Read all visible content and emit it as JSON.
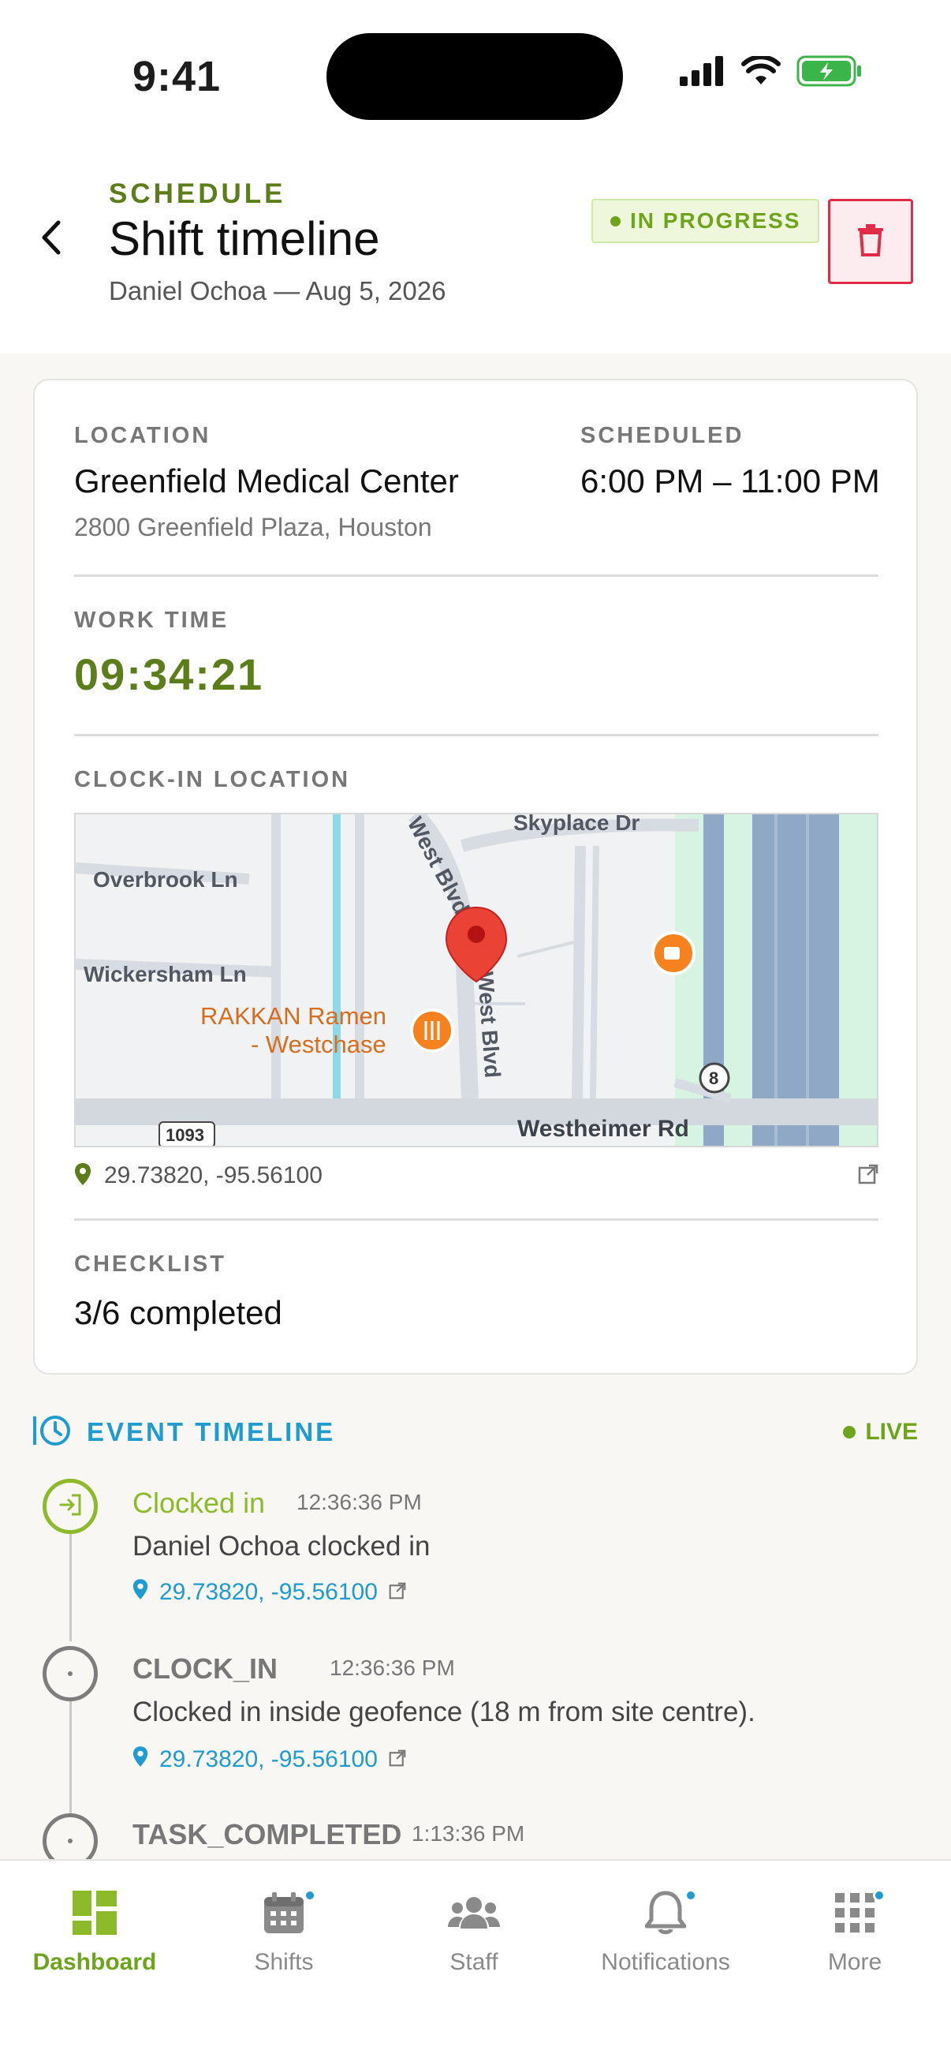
{
  "status_bar": {
    "time": "9:41"
  },
  "header": {
    "eyebrow": "SCHEDULE",
    "title": "Shift timeline",
    "subtitle": "Daniel Ochoa — Aug 5, 2026",
    "status": "IN PROGRESS"
  },
  "details": {
    "location_label": "LOCATION",
    "location_name": "Greenfield Medical Center",
    "location_address": "2800 Greenfield Plaza, Houston",
    "scheduled_label": "SCHEDULED",
    "scheduled_value": "6:00 PM – 11:00 PM",
    "work_time_label": "WORK TIME",
    "work_time": "09:34:21",
    "clockin_label": "CLOCK-IN LOCATION",
    "clockin_coords": "29.73820, -95.56100",
    "checklist_label": "CHECKLIST",
    "checklist_value": "3/6 completed"
  },
  "map": {
    "streets": {
      "skyplace": "Skyplace Dr",
      "overbrook": "Overbrook Ln",
      "wickersham": "Wickersham Ln",
      "westblvd_top": "West Blvd",
      "westblvd": "West Blvd",
      "westheimer": "Westheimer Rd",
      "route_1093": "1093",
      "route_8": "8"
    },
    "poi_line1": "RAKKAN Ramen",
    "poi_line2": "- Westchase"
  },
  "timeline": {
    "title": "EVENT TIMELINE",
    "live_label": "LIVE",
    "events": [
      {
        "title": "Clocked in",
        "time": "12:36:36 PM",
        "description": "Daniel Ochoa clocked in",
        "location": "29.73820, -95.56100"
      },
      {
        "title": "CLOCK_IN",
        "time": "12:36:36 PM",
        "description": "Clocked in inside geofence (18 m from site centre).",
        "location": "29.73820, -95.56100"
      },
      {
        "title": "TASK_COMPLETED",
        "time": "1:13:36 PM"
      }
    ]
  },
  "tabs": [
    {
      "label": "Dashboard",
      "icon": "dashboard-icon",
      "active": true
    },
    {
      "label": "Shifts",
      "icon": "calendar-icon",
      "badge": true
    },
    {
      "label": "Staff",
      "icon": "staff-icon"
    },
    {
      "label": "Notifications",
      "icon": "bell-icon",
      "badge": true
    },
    {
      "label": "More",
      "icon": "grid-icon",
      "badge": true
    }
  ],
  "colors": {
    "brand_green": "#5b7d1a",
    "accent_green": "#8cba2a",
    "accent_blue": "#1f9bd0",
    "danger": "#e12c48"
  }
}
